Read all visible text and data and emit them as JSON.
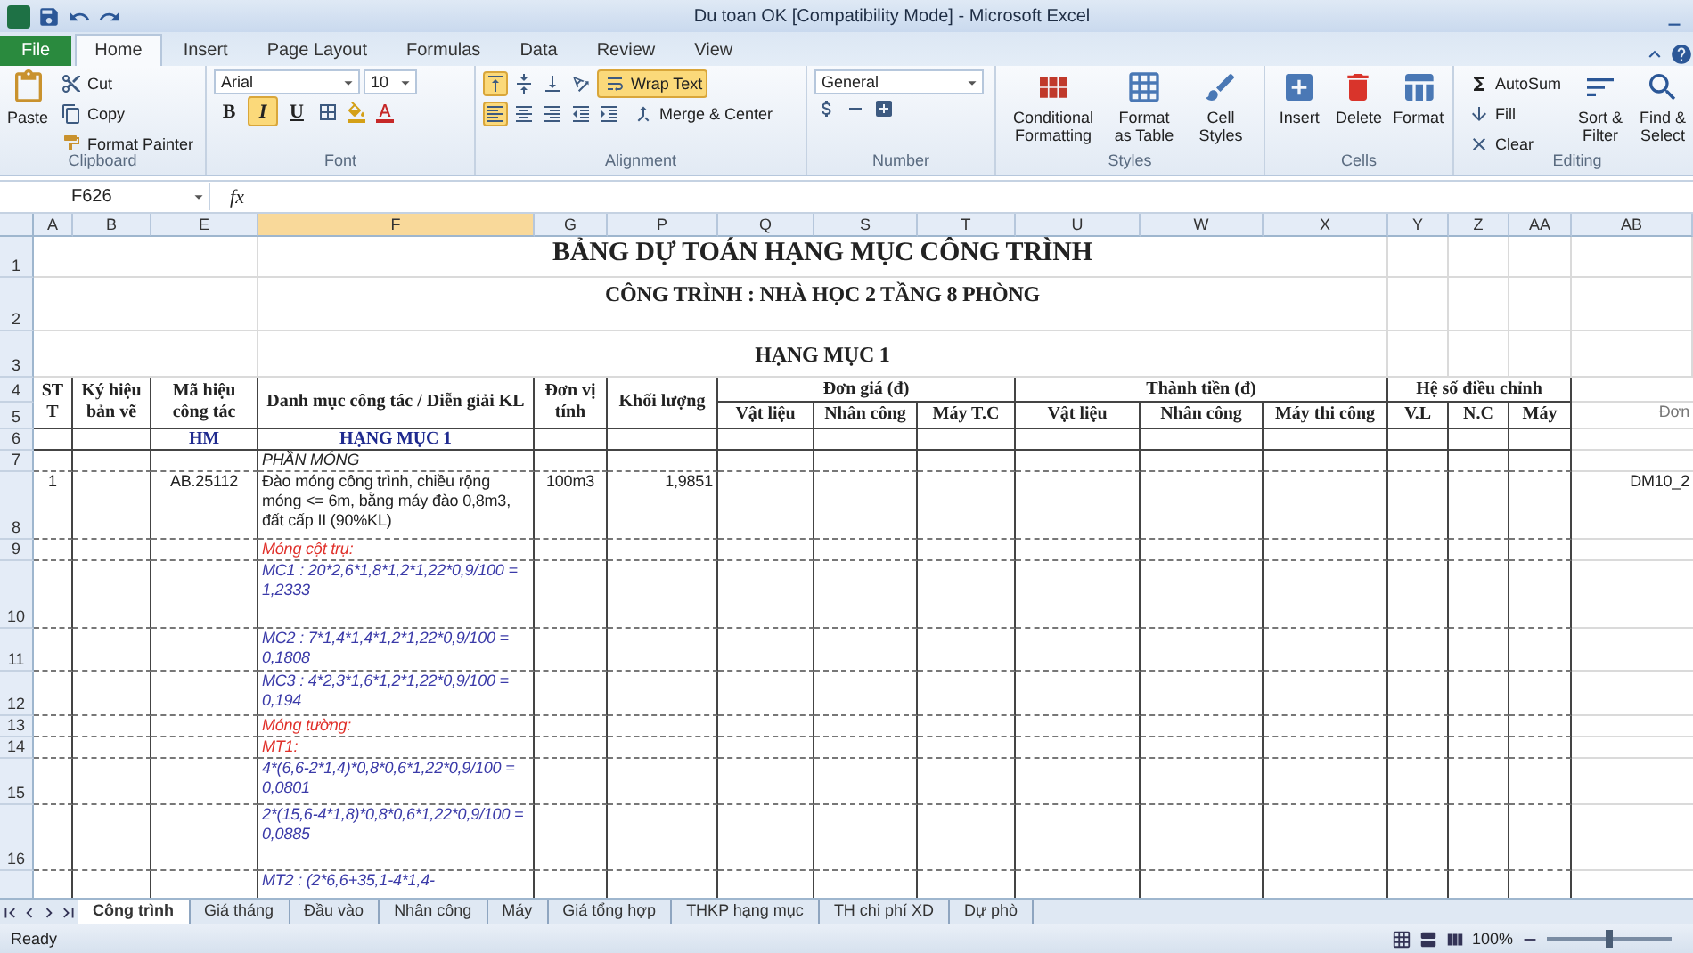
{
  "window": {
    "title": "Du toan OK  [Compatibility Mode]  -  Microsoft Excel"
  },
  "ribbon_tabs": [
    {
      "label": "File",
      "kind": "file",
      "selected": false
    },
    {
      "label": "Home",
      "kind": "tab",
      "selected": true
    },
    {
      "label": "Insert",
      "kind": "tab",
      "selected": false
    },
    {
      "label": "Page Layout",
      "kind": "tab",
      "selected": false
    },
    {
      "label": "Formulas",
      "kind": "tab",
      "selected": false
    },
    {
      "label": "Data",
      "kind": "tab",
      "selected": false
    },
    {
      "label": "Review",
      "kind": "tab",
      "selected": false
    },
    {
      "label": "View",
      "kind": "tab",
      "selected": false
    }
  ],
  "clipboard": {
    "name": "Clipboard",
    "paste": "Paste",
    "cut": "Cut",
    "copy": "Copy",
    "format_painter": "Format Painter"
  },
  "font": {
    "name": "Font",
    "face": "Arial",
    "size": "10",
    "styles": [
      {
        "label": "B",
        "selected": false
      },
      {
        "label": "I",
        "selected": true
      },
      {
        "label": "U",
        "selected": false
      }
    ]
  },
  "alignment": {
    "name": "Alignment",
    "vertical": [
      {
        "selected": true
      },
      {
        "selected": false
      },
      {
        "selected": false
      }
    ],
    "horizontal": [
      {
        "selected": true
      },
      {
        "selected": false
      },
      {
        "selected": false
      }
    ],
    "wrap_text": {
      "label": "Wrap Text",
      "on": true
    },
    "merge": "Merge & Center"
  },
  "number": {
    "name": "Number",
    "format": "General"
  },
  "styles": {
    "name": "Styles",
    "buttons": [
      "Conditional Formatting",
      "Format as Table",
      "Cell Styles"
    ]
  },
  "cells": {
    "name": "Cells",
    "buttons": [
      "Insert",
      "Delete",
      "Format"
    ]
  },
  "editing": {
    "name": "Editing",
    "autosum": "AutoSum",
    "fill": "Fill",
    "clear": "Clear",
    "sort": "Sort & Filter",
    "find": "Find & Select"
  },
  "name_box": "F626",
  "formula_label": "fx",
  "columns": [
    {
      "label": "A",
      "selected": false
    },
    {
      "label": "B",
      "selected": false
    },
    {
      "label": "E",
      "selected": false
    },
    {
      "label": "F",
      "selected": true
    },
    {
      "label": "G",
      "selected": false
    },
    {
      "label": "P",
      "selected": false
    },
    {
      "label": "Q",
      "selected": false
    },
    {
      "label": "S",
      "selected": false
    },
    {
      "label": "T",
      "selected": false
    },
    {
      "label": "U",
      "selected": false
    },
    {
      "label": "W",
      "selected": false
    },
    {
      "label": "X",
      "selected": false
    },
    {
      "label": "Y",
      "selected": false
    },
    {
      "label": "Z",
      "selected": false
    },
    {
      "label": "AA",
      "selected": false
    },
    {
      "label": "AB",
      "selected": false
    }
  ],
  "titles": [
    {
      "number": "1",
      "kind": "title",
      "text": "BẢNG DỰ TOÁN HẠNG MỤC CÔNG TRÌNH"
    },
    {
      "number": "2",
      "kind": "subtitle",
      "text": "CÔNG TRÌNH : NHÀ HỌC 2 TẦNG 8 PHÒNG"
    },
    {
      "number": "3",
      "kind": "section",
      "text": "HẠNG MỤC 1"
    }
  ],
  "header": {
    "numbers": [
      "4",
      "5"
    ],
    "stt": "STT",
    "drawing_code": "Ký hiệu bản vẽ",
    "work_code": "Mã hiệu công tác",
    "description": "Danh mục công tác / Diễn giải KL",
    "unit": "Đơn vị tính",
    "quantity": "Khối lượng",
    "groups": [
      {
        "label": "Đơn giá (đ)",
        "columns": [
          "Vật liệu",
          "Nhân công",
          "Máy T.C"
        ]
      },
      {
        "label": "Thành tiền (đ)",
        "columns": [
          "Vật liệu",
          "Nhân công",
          "Máy thi công"
        ]
      },
      {
        "label": "Hệ số điều chỉnh",
        "columns": [
          "V.L",
          "N.C",
          "Máy"
        ]
      }
    ],
    "note": "Đơn"
  },
  "rows": [
    {
      "number": "6",
      "kind": "item",
      "work_code": "HM",
      "description": "HẠNG MỤC 1"
    },
    {
      "number": "7",
      "kind": "section",
      "description": "PHẦN MÓNG"
    },
    {
      "number": "8",
      "kind": "task",
      "stt": "1",
      "work_code": "AB.25112",
      "description": "Đào móng công trình, chiều rộng móng <= 6m, bằng máy đào 0,8m3, đất cấp II (90%KL)",
      "unit": "100m3",
      "quantity": "1,9851",
      "note": "DM10_2"
    },
    {
      "number": "9",
      "kind": "group",
      "description": "Móng cột trụ:"
    },
    {
      "number": "10",
      "kind": "formula",
      "description": "MC1 : 20*2,6*1,8*1,2*1,22*0,9/100 = 1,2333"
    },
    {
      "number": "11",
      "kind": "formula",
      "description": "MC2 : 7*1,4*1,4*1,2*1,22*0,9/100 = 0,1808"
    },
    {
      "number": "12",
      "kind": "formula",
      "description": "MC3 : 4*2,3*1,6*1,2*1,22*0,9/100 = 0,194"
    },
    {
      "number": "13",
      "kind": "group",
      "description": "Móng tường:"
    },
    {
      "number": "14",
      "kind": "group",
      "description": "MT1:"
    },
    {
      "number": "15",
      "kind": "formula",
      "description": "4*(6,6-2*1,4)*0,8*0,6*1,22*0,9/100 = 0,0801"
    },
    {
      "number": "16",
      "kind": "formula",
      "description": "2*(15,6-4*1,8)*0,8*0,6*1,22*0,9/100 = 0,0885"
    },
    {
      "kind": "formula",
      "description": "MT2 : (2*6,6+35,1-4*1,4-"
    }
  ],
  "sheet_tabs": [
    {
      "label": "Công trình",
      "selected": true
    },
    {
      "label": "Giá tháng",
      "selected": false
    },
    {
      "label": "Đầu vào",
      "selected": false
    },
    {
      "label": "Nhân công",
      "selected": false
    },
    {
      "label": "Máy",
      "selected": false
    },
    {
      "label": "Giá tổng hợp",
      "selected": false
    },
    {
      "label": "THKP hạng mục",
      "selected": false
    },
    {
      "label": "TH chi phí XD",
      "selected": false
    },
    {
      "label": "Dự phò",
      "selected": false
    }
  ],
  "status": "Ready",
  "zoom": {
    "reading": "100%",
    "level": 0.5
  }
}
